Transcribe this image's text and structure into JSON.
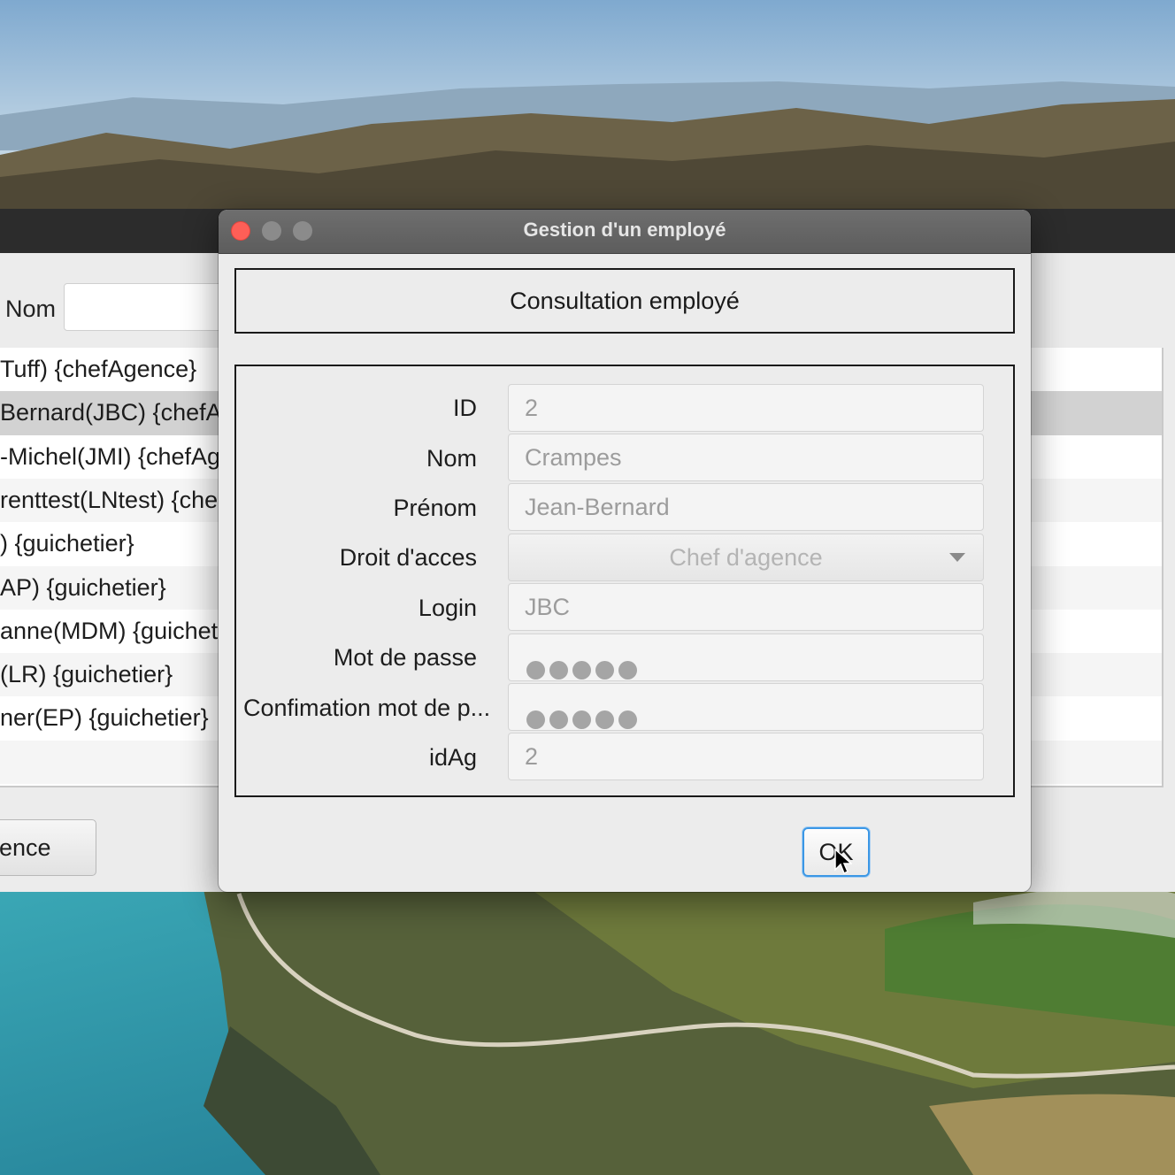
{
  "background_window": {
    "nom_label": "Nom",
    "list_rows": [
      "Tuff) {chefAgence}",
      "Bernard(JBC) {chefA",
      "-Michel(JMI) {chefAg",
      "renttest(LNtest) {che",
      ") {guichetier}",
      "AP) {guichetier}",
      "anne(MDM) {guicheti",
      "(LR) {guichetier}",
      "ner(EP) {guichetier}",
      ""
    ],
    "selected_row_index": 1,
    "button_label": "ence"
  },
  "dialog": {
    "title": "Gestion d'un employé",
    "header": "Consultation employé",
    "fields": [
      {
        "label": "ID",
        "value": "2"
      },
      {
        "label": "Nom",
        "value": "Crampes"
      },
      {
        "label": "Prénom",
        "value": "Jean-Bernard"
      },
      {
        "label": "Droit d'acces",
        "value": "Chef d'agence"
      },
      {
        "label": "Login",
        "value": "JBC"
      },
      {
        "label": "Mot de passe",
        "masked_length": 5
      },
      {
        "label": "Confimation mot de p...",
        "masked_length": 5
      },
      {
        "label": "idAg",
        "value": "2"
      }
    ],
    "ok_label": "OK"
  },
  "icons": {
    "close": "close-button-icon",
    "minimize": "minimize-button-icon",
    "maximize": "maximize-button-icon",
    "dropdown": "chevron-down-icon",
    "cursor": "mouse-pointer-icon"
  },
  "colors": {
    "close_button": "#fe5f57",
    "focus_ring": "#3b97e5",
    "selected_row": "#d2d2d2"
  }
}
